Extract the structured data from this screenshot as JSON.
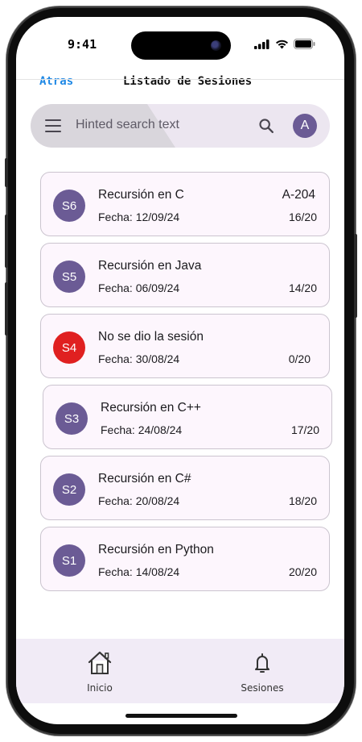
{
  "status_bar": {
    "time": "9:41"
  },
  "header": {
    "back_label": "Atras",
    "title": "Listado de Sesiones"
  },
  "search": {
    "placeholder": "Hinted search text",
    "avatar_letter": "A"
  },
  "sessions": [
    {
      "badge": "S6",
      "title": "Recursión en C",
      "date": "Fecha: 12/09/24",
      "room": "A-204",
      "score": "16/20",
      "status": "normal"
    },
    {
      "badge": "S5",
      "title": "Recursión en Java",
      "date": "Fecha: 06/09/24",
      "room": "",
      "score": "14/20",
      "status": "normal"
    },
    {
      "badge": "S4",
      "title": "No se dio la sesión",
      "date": "Fecha: 30/08/24",
      "room": "",
      "score": "0/20",
      "status": "cancelled"
    },
    {
      "badge": "S3",
      "title": "Recursión en C++",
      "date": "Fecha: 24/08/24",
      "room": "",
      "score": "17/20",
      "status": "normal"
    },
    {
      "badge": "S2",
      "title": "Recursión en C#",
      "date": "Fecha: 20/08/24",
      "room": "",
      "score": "18/20",
      "status": "normal"
    },
    {
      "badge": "S1",
      "title": "Recursión en Python",
      "date": "Fecha: 14/08/24",
      "room": "",
      "score": "20/20",
      "status": "normal"
    }
  ],
  "bottom_nav": [
    {
      "label": "Inicio",
      "icon": "home-icon"
    },
    {
      "label": "Sesiones",
      "icon": "bell-icon"
    }
  ],
  "colors": {
    "accent": "#6b5b95",
    "cancelled": "#e02020",
    "link": "#1e88e5",
    "card_bg": "#fdf6fd"
  }
}
